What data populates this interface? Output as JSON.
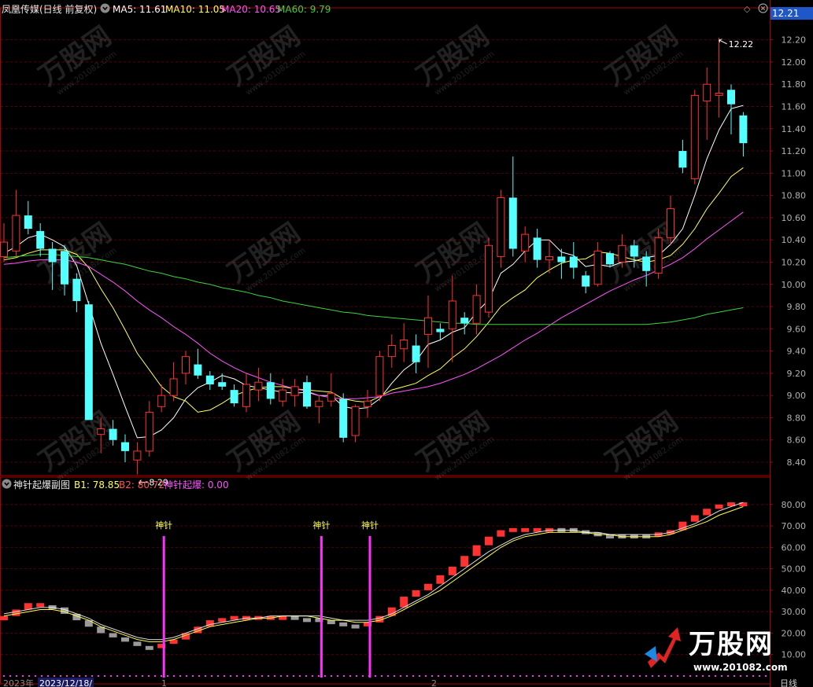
{
  "header": {
    "title": "凤凰传媒(日线 前复权)",
    "ma5_label": "MA5: 11.61",
    "ma10_label": "MA10: 11.05",
    "ma20_label": "MA20: 10.65",
    "ma60_label": "MA60: 9.79",
    "last_price_badge": "12.21"
  },
  "sub_header": {
    "title": "神针起爆副图",
    "b1_label": "B1: 78.85",
    "b2_label": "B2: 80.72",
    "signal_label": "神针起爆: 0.00"
  },
  "bottom": {
    "date_left": "2023年",
    "date_cursor": "2023/12/18/",
    "tick_1": "1",
    "tick_2": "2",
    "period_label": "日线"
  },
  "watermark": {
    "brand": "万股网",
    "url": "www.201082.com"
  },
  "colors": {
    "up": "#ff3232",
    "down": "#54ffff",
    "ma5": "#ffffff",
    "ma10": "#ffff54",
    "ma20": "#ff54ff",
    "ma60": "#3ed23e",
    "grid": "#5a0000",
    "frame": "#aa0000",
    "axis_text": "#b0b0b0",
    "signal": "#ff30ff",
    "gray_bar": "#9a9a9a"
  },
  "chart_data": [
    {
      "type": "candlestick",
      "title": "凤凰传媒(日线 前复权)",
      "ylim": [
        8.28,
        12.36
      ],
      "yticks": [
        8.4,
        8.6,
        8.8,
        9.0,
        9.2,
        9.4,
        9.6,
        9.8,
        10.0,
        10.2,
        10.4,
        10.6,
        10.8,
        11.0,
        11.2,
        11.4,
        11.6,
        11.8,
        12.0,
        12.2
      ],
      "annotations": [
        {
          "label": "12.22",
          "value": 12.22,
          "type": "high"
        },
        {
          "label": "8.29",
          "value": 8.29,
          "type": "low"
        }
      ],
      "candles": [
        {
          "o": 10.25,
          "h": 10.55,
          "l": 10.2,
          "c": 10.38
        },
        {
          "o": 10.3,
          "h": 10.85,
          "l": 10.25,
          "c": 10.62
        },
        {
          "o": 10.62,
          "h": 10.75,
          "l": 10.45,
          "c": 10.5
        },
        {
          "o": 10.48,
          "h": 10.55,
          "l": 10.25,
          "c": 10.32
        },
        {
          "o": 10.32,
          "h": 10.38,
          "l": 9.95,
          "c": 10.2
        },
        {
          "o": 10.3,
          "h": 10.35,
          "l": 9.9,
          "c": 10.0
        },
        {
          "o": 10.05,
          "h": 10.1,
          "l": 9.75,
          "c": 9.85
        },
        {
          "o": 9.82,
          "h": 9.85,
          "l": 8.78,
          "c": 8.78
        },
        {
          "o": 8.65,
          "h": 8.8,
          "l": 8.48,
          "c": 8.7
        },
        {
          "o": 8.7,
          "h": 8.78,
          "l": 8.55,
          "c": 8.6
        },
        {
          "o": 8.58,
          "h": 8.65,
          "l": 8.4,
          "c": 8.5
        },
        {
          "o": 8.42,
          "h": 8.58,
          "l": 8.29,
          "c": 8.5
        },
        {
          "o": 8.5,
          "h": 8.95,
          "l": 8.45,
          "c": 8.85
        },
        {
          "o": 8.9,
          "h": 9.1,
          "l": 8.85,
          "c": 9.0
        },
        {
          "o": 9.0,
          "h": 9.3,
          "l": 8.95,
          "c": 9.15
        },
        {
          "o": 9.2,
          "h": 9.4,
          "l": 9.1,
          "c": 9.35
        },
        {
          "o": 9.28,
          "h": 9.42,
          "l": 9.15,
          "c": 9.18
        },
        {
          "o": 9.18,
          "h": 9.22,
          "l": 9.05,
          "c": 9.1
        },
        {
          "o": 9.12,
          "h": 9.2,
          "l": 9.05,
          "c": 9.08
        },
        {
          "o": 9.05,
          "h": 9.1,
          "l": 8.9,
          "c": 8.93
        },
        {
          "o": 8.9,
          "h": 9.2,
          "l": 8.85,
          "c": 9.1
        },
        {
          "o": 9.05,
          "h": 9.25,
          "l": 8.95,
          "c": 9.12
        },
        {
          "o": 9.12,
          "h": 9.2,
          "l": 8.92,
          "c": 8.97
        },
        {
          "o": 8.95,
          "h": 9.15,
          "l": 8.9,
          "c": 9.05
        },
        {
          "o": 9.0,
          "h": 9.15,
          "l": 8.9,
          "c": 9.08
        },
        {
          "o": 9.12,
          "h": 9.18,
          "l": 8.88,
          "c": 8.9
        },
        {
          "o": 8.9,
          "h": 9.0,
          "l": 8.75,
          "c": 8.95
        },
        {
          "o": 8.95,
          "h": 9.2,
          "l": 8.9,
          "c": 9.02
        },
        {
          "o": 8.97,
          "h": 9.02,
          "l": 8.58,
          "c": 8.62
        },
        {
          "o": 8.64,
          "h": 8.92,
          "l": 8.58,
          "c": 8.9
        },
        {
          "o": 8.9,
          "h": 9.05,
          "l": 8.8,
          "c": 8.95
        },
        {
          "o": 9.0,
          "h": 9.4,
          "l": 8.95,
          "c": 9.35
        },
        {
          "o": 9.35,
          "h": 9.55,
          "l": 9.25,
          "c": 9.45
        },
        {
          "o": 9.42,
          "h": 9.65,
          "l": 9.3,
          "c": 9.5
        },
        {
          "o": 9.45,
          "h": 9.55,
          "l": 9.2,
          "c": 9.3
        },
        {
          "o": 9.55,
          "h": 9.9,
          "l": 9.25,
          "c": 9.7
        },
        {
          "o": 9.6,
          "h": 9.65,
          "l": 9.5,
          "c": 9.57
        },
        {
          "o": 9.6,
          "h": 10.08,
          "l": 9.3,
          "c": 9.85
        },
        {
          "o": 9.7,
          "h": 9.75,
          "l": 9.55,
          "c": 9.65
        },
        {
          "o": 9.65,
          "h": 10.0,
          "l": 9.55,
          "c": 9.9
        },
        {
          "o": 9.75,
          "h": 10.42,
          "l": 9.7,
          "c": 10.35
        },
        {
          "o": 10.25,
          "h": 10.85,
          "l": 10.15,
          "c": 10.78
        },
        {
          "o": 10.78,
          "h": 11.15,
          "l": 10.25,
          "c": 10.32
        },
        {
          "o": 10.3,
          "h": 10.52,
          "l": 10.2,
          "c": 10.45
        },
        {
          "o": 10.42,
          "h": 10.5,
          "l": 10.15,
          "c": 10.22
        },
        {
          "o": 10.22,
          "h": 10.4,
          "l": 10.1,
          "c": 10.25
        },
        {
          "o": 10.25,
          "h": 10.32,
          "l": 10.05,
          "c": 10.2
        },
        {
          "o": 10.25,
          "h": 10.38,
          "l": 10.05,
          "c": 10.15
        },
        {
          "o": 10.08,
          "h": 10.12,
          "l": 9.92,
          "c": 9.98
        },
        {
          "o": 10.0,
          "h": 10.38,
          "l": 9.98,
          "c": 10.3
        },
        {
          "o": 10.28,
          "h": 10.3,
          "l": 10.15,
          "c": 10.18
        },
        {
          "o": 10.2,
          "h": 10.45,
          "l": 10.15,
          "c": 10.35
        },
        {
          "o": 10.35,
          "h": 10.4,
          "l": 10.15,
          "c": 10.25
        },
        {
          "o": 10.25,
          "h": 10.3,
          "l": 9.98,
          "c": 10.12
        },
        {
          "o": 10.1,
          "h": 10.5,
          "l": 10.05,
          "c": 10.42
        },
        {
          "o": 10.42,
          "h": 10.8,
          "l": 10.35,
          "c": 10.68
        },
        {
          "o": 11.2,
          "h": 11.3,
          "l": 11.0,
          "c": 11.05
        },
        {
          "o": 10.95,
          "h": 11.75,
          "l": 10.9,
          "c": 11.7
        },
        {
          "o": 11.65,
          "h": 11.95,
          "l": 11.3,
          "c": 11.8
        },
        {
          "o": 11.7,
          "h": 12.22,
          "l": 11.5,
          "c": 11.72
        },
        {
          "o": 11.75,
          "h": 11.8,
          "l": 11.35,
          "c": 11.62
        },
        {
          "o": 11.52,
          "h": 11.55,
          "l": 11.15,
          "c": 11.27
        }
      ],
      "series": [
        {
          "name": "MA5",
          "values": [
            10.28,
            10.34,
            10.42,
            10.45,
            10.4,
            10.34,
            10.17,
            9.82,
            9.47,
            9.19,
            8.9,
            8.62,
            8.63,
            8.69,
            8.8,
            8.97,
            9.07,
            9.12,
            9.18,
            9.15,
            9.09,
            9.07,
            9.05,
            9.03,
            9.02,
            9.03,
            9.0,
            9.0,
            8.9,
            8.88,
            8.89,
            8.97,
            9.11,
            9.23,
            9.31,
            9.46,
            9.5,
            9.57,
            9.61,
            9.75,
            9.86,
            10.1,
            10.18,
            10.3,
            10.4,
            10.4,
            10.29,
            10.26,
            10.16,
            10.18,
            10.16,
            10.2,
            10.21,
            10.24,
            10.26,
            10.36,
            10.5,
            10.8,
            11.13,
            11.39,
            11.58,
            11.61
          ]
        },
        {
          "name": "MA10",
          "values": [
            10.22,
            10.24,
            10.28,
            10.31,
            10.31,
            10.31,
            10.27,
            10.15,
            9.96,
            9.79,
            9.59,
            9.38,
            9.23,
            9.08,
            8.99,
            8.95,
            8.85,
            8.87,
            8.93,
            9.0,
            9.04,
            9.07,
            9.08,
            9.08,
            9.06,
            9.05,
            9.04,
            9.03,
            8.97,
            8.95,
            8.94,
            8.99,
            9.05,
            9.08,
            9.11,
            9.18,
            9.24,
            9.34,
            9.42,
            9.53,
            9.66,
            9.8,
            9.88,
            9.95,
            10.06,
            10.13,
            10.19,
            10.22,
            10.23,
            10.29,
            10.28,
            10.25,
            10.22,
            10.2,
            10.22,
            10.26,
            10.36,
            10.5,
            10.68,
            10.82,
            10.97,
            11.05
          ]
        },
        {
          "name": "MA20",
          "values": [
            10.18,
            10.19,
            10.21,
            10.22,
            10.22,
            10.22,
            10.2,
            10.16,
            10.09,
            10.02,
            9.94,
            9.85,
            9.77,
            9.7,
            9.62,
            9.55,
            9.47,
            9.38,
            9.31,
            9.25,
            9.2,
            9.16,
            9.12,
            9.09,
            9.06,
            9.04,
            9.0,
            8.98,
            8.97,
            8.97,
            8.98,
            8.99,
            9.02,
            9.04,
            9.06,
            9.08,
            9.11,
            9.15,
            9.19,
            9.24,
            9.3,
            9.36,
            9.43,
            9.5,
            9.56,
            9.63,
            9.7,
            9.76,
            9.82,
            9.88,
            9.94,
            9.99,
            10.04,
            10.08,
            10.13,
            10.18,
            10.24,
            10.32,
            10.41,
            10.49,
            10.57,
            10.65
          ]
        },
        {
          "name": "MA60",
          "values": [
            10.24,
            10.25,
            10.26,
            10.27,
            10.27,
            10.26,
            10.25,
            10.24,
            10.22,
            10.2,
            10.18,
            10.15,
            10.12,
            10.1,
            10.07,
            10.05,
            10.02,
            10.0,
            9.97,
            9.95,
            9.93,
            9.9,
            9.88,
            9.85,
            9.83,
            9.81,
            9.79,
            9.77,
            9.75,
            9.74,
            9.72,
            9.71,
            9.7,
            9.69,
            9.68,
            9.67,
            9.66,
            9.65,
            9.65,
            9.64,
            9.64,
            9.64,
            9.64,
            9.64,
            9.64,
            9.64,
            9.64,
            9.64,
            9.64,
            9.64,
            9.64,
            9.64,
            9.64,
            9.64,
            9.65,
            9.66,
            9.68,
            9.7,
            9.73,
            9.75,
            9.77,
            9.79
          ]
        }
      ]
    },
    {
      "type": "bar",
      "title": "神针起爆副图",
      "ylim": [
        0,
        88
      ],
      "yticks": [
        10.0,
        20.0,
        30.0,
        40.0,
        50.0,
        60.0,
        70.0,
        80.0
      ],
      "bar_colors_legend": [
        "up:red",
        "down:gray"
      ],
      "values": [
        28,
        31,
        34,
        33,
        32,
        29,
        26,
        23,
        20,
        18,
        16,
        14,
        13,
        15,
        17,
        20,
        23,
        26,
        27,
        28,
        28,
        28,
        28,
        28,
        27,
        27,
        26,
        25,
        24,
        24,
        25,
        28,
        32,
        37,
        40,
        43,
        47,
        51,
        56,
        61,
        65,
        68,
        69,
        69,
        69,
        69,
        69,
        68,
        67,
        66,
        66,
        66,
        66,
        66,
        67,
        68,
        72,
        75,
        78,
        80,
        81,
        80
      ],
      "bar_up": [
        1,
        1,
        1,
        1,
        0,
        0,
        0,
        0,
        0,
        0,
        0,
        0,
        0,
        1,
        1,
        1,
        1,
        1,
        1,
        1,
        1,
        1,
        1,
        1,
        0,
        0,
        0,
        0,
        0,
        0,
        1,
        1,
        1,
        1,
        1,
        1,
        1,
        1,
        1,
        1,
        1,
        1,
        1,
        1,
        1,
        1,
        0,
        0,
        0,
        0,
        0,
        0,
        0,
        0,
        1,
        1,
        1,
        1,
        1,
        1,
        1,
        1
      ],
      "series": [
        {
          "name": "B1",
          "values": [
            28,
            29,
            30,
            31,
            31,
            30,
            28,
            26,
            23,
            21,
            19,
            17,
            16,
            16,
            17,
            19,
            21,
            23,
            24,
            25,
            26,
            27,
            27,
            28,
            28,
            28,
            27,
            26,
            26,
            25,
            25,
            26,
            28,
            31,
            34,
            37,
            40,
            44,
            48,
            52,
            56,
            60,
            63,
            65,
            66,
            67,
            67,
            67,
            67,
            66,
            66,
            65,
            65,
            65,
            65,
            66,
            68,
            70,
            72,
            75,
            77,
            79
          ]
        },
        {
          "name": "B2",
          "values": [
            29,
            30,
            31,
            32,
            32,
            31,
            29,
            27,
            24,
            22,
            20,
            18,
            17,
            17,
            18,
            20,
            22,
            24,
            25,
            26,
            27,
            27,
            28,
            28,
            28,
            28,
            28,
            27,
            26,
            26,
            26,
            27,
            29,
            32,
            35,
            38,
            42,
            46,
            50,
            54,
            58,
            61,
            64,
            66,
            67,
            68,
            68,
            68,
            67,
            67,
            66,
            66,
            66,
            66,
            66,
            67,
            69,
            71,
            74,
            77,
            79,
            81
          ]
        }
      ],
      "signals": [
        {
          "label": "神针",
          "index": 13
        },
        {
          "label": "神针",
          "index": 26
        },
        {
          "label": "神针",
          "index": 30
        }
      ]
    }
  ]
}
